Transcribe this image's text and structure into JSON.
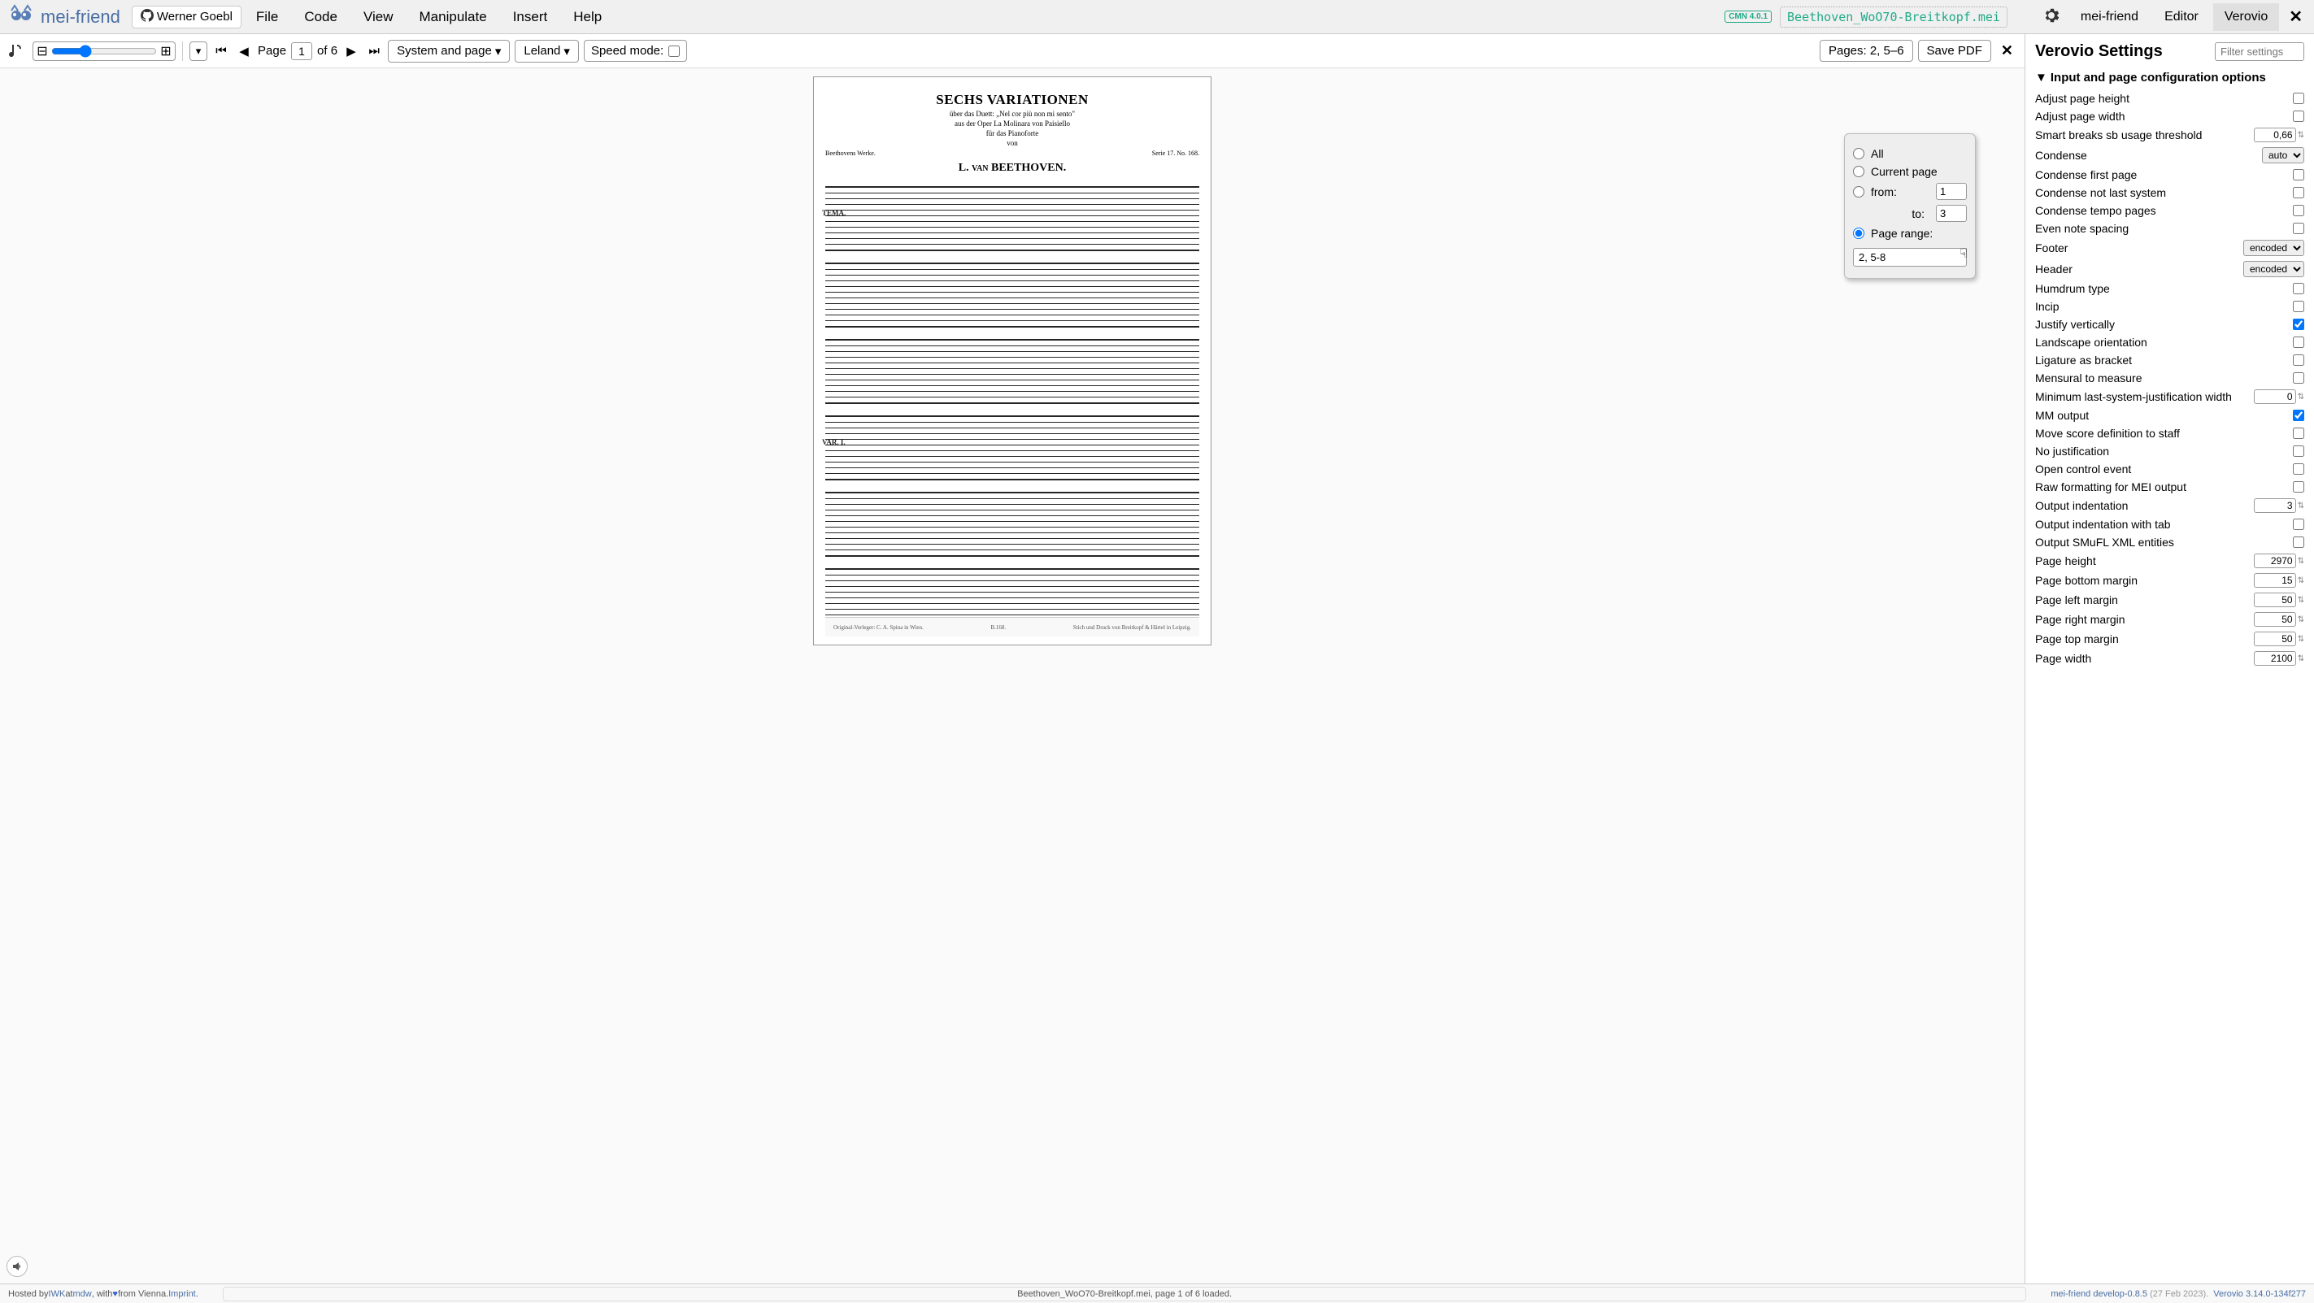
{
  "brand": "mei-friend",
  "github_user": "Werner Goebl",
  "menu": [
    "File",
    "Code",
    "View",
    "Manipulate",
    "Insert",
    "Help"
  ],
  "cmn_badge": "CMN 4.0.1",
  "filename": "Beethoven_WoO70-Breitkopf.mei",
  "tabs": [
    "mei-friend",
    "Editor",
    "Verovio"
  ],
  "active_tab": 2,
  "toolbar": {
    "page_label": "Page",
    "page_value": "1",
    "page_total": "of 6",
    "breaks": "System and page",
    "font": "Leland",
    "speed_label": "Speed mode:",
    "pages_btn": "Pages: 2, 5–6",
    "save_pdf": "Save PDF"
  },
  "score": {
    "title": "SECHS VARIATIONEN",
    "sub1": "über das Duett: „Nel cor più non mi sento\"",
    "sub2": "aus der Oper La Molinara von Paisiello",
    "sub3": "für das Pianoforte",
    "sub4": "von",
    "composer": "L. van  BEETHOVEN.",
    "left": "Beethovens Werke.",
    "right": "Serie 17. No. 168.",
    "tema": "TEMA.",
    "var1": "VAR. I.",
    "foot_left": "Original-Verleger: C. A. Spina in Wien.",
    "foot_mid": "B.168.",
    "foot_right": "Stich und Druck von Breitkopf & Härtel in Leipzig."
  },
  "popup": {
    "all": "All",
    "current": "Current page",
    "from_label": "from:",
    "from_value": "1",
    "to_label": "to:",
    "to_value": "3",
    "range_label": "Page range:",
    "range_value": "2, 5-8"
  },
  "settings": {
    "title": "Verovio Settings",
    "filter_ph": "Filter settings",
    "section": "Input and page configuration options",
    "rows": [
      {
        "label": "Adjust page height",
        "type": "check",
        "value": false
      },
      {
        "label": "Adjust page width",
        "type": "check",
        "value": false
      },
      {
        "label": "Smart breaks sb usage threshold",
        "type": "num",
        "value": "0,66"
      },
      {
        "label": "Condense",
        "type": "select",
        "value": "auto"
      },
      {
        "label": "Condense first page",
        "type": "check",
        "value": false
      },
      {
        "label": "Condense not last system",
        "type": "check",
        "value": false
      },
      {
        "label": "Condense tempo pages",
        "type": "check",
        "value": false
      },
      {
        "label": "Even note spacing",
        "type": "check",
        "value": false
      },
      {
        "label": "Footer",
        "type": "select",
        "value": "encoded"
      },
      {
        "label": "Header",
        "type": "select",
        "value": "encoded"
      },
      {
        "label": "Humdrum type",
        "type": "check",
        "value": false
      },
      {
        "label": "Incip",
        "type": "check",
        "value": false
      },
      {
        "label": "Justify vertically",
        "type": "check",
        "value": true
      },
      {
        "label": "Landscape orientation",
        "type": "check",
        "value": false
      },
      {
        "label": "Ligature as bracket",
        "type": "check",
        "value": false
      },
      {
        "label": "Mensural to measure",
        "type": "check",
        "value": false
      },
      {
        "label": "Minimum last-system-justification width",
        "type": "num",
        "value": "0"
      },
      {
        "label": "MM output",
        "type": "check",
        "value": true
      },
      {
        "label": "Move score definition to staff",
        "type": "check",
        "value": false
      },
      {
        "label": "No justification",
        "type": "check",
        "value": false
      },
      {
        "label": "Open control event",
        "type": "check",
        "value": false
      },
      {
        "label": "Raw formatting for MEI output",
        "type": "check",
        "value": false
      },
      {
        "label": "Output indentation",
        "type": "num",
        "value": "3"
      },
      {
        "label": "Output indentation with tab",
        "type": "check",
        "value": false
      },
      {
        "label": "Output SMuFL XML entities",
        "type": "check",
        "value": false
      },
      {
        "label": "Page height",
        "type": "num",
        "value": "2970"
      },
      {
        "label": "Page bottom margin",
        "type": "num",
        "value": "15"
      },
      {
        "label": "Page left margin",
        "type": "num",
        "value": "50"
      },
      {
        "label": "Page right margin",
        "type": "num",
        "value": "50"
      },
      {
        "label": "Page top margin",
        "type": "num",
        "value": "50"
      },
      {
        "label": "Page width",
        "type": "num",
        "value": "2100"
      }
    ]
  },
  "footer": {
    "hosted": "Hosted by ",
    "iwk": "IWK",
    "at": " at ",
    "mdw": "mdw",
    "with": ", with ",
    "from": " from Vienna. ",
    "imprint": "Imprint",
    "status": "Beethoven_WoO70-Breitkopf.mei, page 1 of 6 loaded.",
    "ver1a": "mei-friend develop-0.8.5",
    "ver1b": " (27 Feb 2023).",
    "ver2": "Verovio 3.14.0-134f277"
  }
}
